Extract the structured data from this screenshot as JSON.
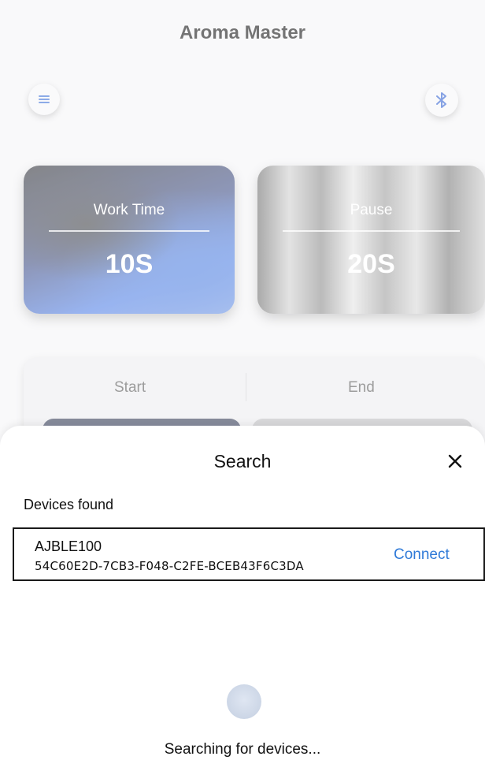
{
  "app": {
    "title": "Aroma Master"
  },
  "cards": {
    "work": {
      "label": "Work Time",
      "value": "10S"
    },
    "pause": {
      "label": "Pause",
      "value": "20S"
    }
  },
  "segment": {
    "start_label": "Start",
    "end_label": "End"
  },
  "sheet": {
    "title": "Search",
    "section_label": "Devices found",
    "devices": [
      {
        "name": "AJBLE100",
        "id": "54C60E2D-7CB3-F048-C2FE-BCEB43F6C3DA",
        "action_label": "Connect"
      }
    ],
    "status": "Searching for devices..."
  },
  "colors": {
    "accent": "#2f7ad8",
    "menu_icon": "#3b6fd6",
    "bluetooth_icon": "#2f5fd0"
  },
  "icons": {
    "menu": "menu-icon",
    "bluetooth": "bluetooth-icon",
    "close": "close-icon"
  }
}
